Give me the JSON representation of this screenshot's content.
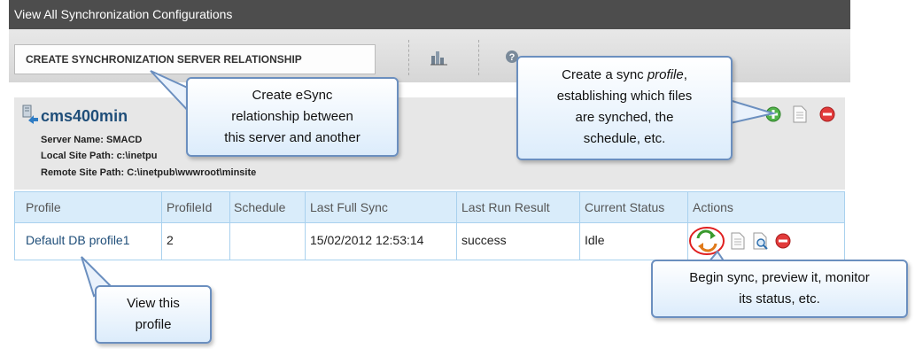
{
  "window": {
    "title": "View All Synchronization Configurations"
  },
  "toolbar": {
    "create_label": "CREATE SYNCHRONIZATION SERVER RELATIONSHIP"
  },
  "server": {
    "name": "cms400min",
    "server_name_label": "Server Name:",
    "server_name_value": "SMACD",
    "local_label": "Local Site Path:",
    "local_value": "c:\\inetpu",
    "remote_label": "Remote Site Path:",
    "remote_value": "C:\\inetpub\\wwwroot\\minsite"
  },
  "table": {
    "headers": [
      "Profile",
      "ProfileId",
      "Schedule",
      "Last Full Sync",
      "Last Run Result",
      "Current Status",
      "Actions"
    ],
    "rows": [
      {
        "profile": "Default DB profile1",
        "profile_id": "2",
        "schedule": "",
        "last_full_sync": "15/02/2012 12:53:14",
        "last_run_result": "success",
        "current_status": "Idle"
      }
    ]
  },
  "callouts": {
    "esync_line1": "Create eSync",
    "esync_line2": "relationship between",
    "esync_line3": "this server and another",
    "profile_line1": "Create a sync ",
    "profile_italic": "profile",
    "profile_line1_end": ",",
    "profile_line2": "establishing which files",
    "profile_line3": "are synched, the",
    "profile_line4": "schedule, etc.",
    "begin_line1": "Begin sync, preview it, monitor",
    "begin_line2": "its status, etc.",
    "view_line1": "View this",
    "view_line2": "profile"
  },
  "icons": {
    "server": "server-sync-icon",
    "add": "add-profile-icon",
    "doc": "document-icon",
    "delete": "delete-icon",
    "sync": "sync-start-icon",
    "preview": "preview-icon",
    "monitor": "monitor-icon",
    "help": "help-icon",
    "chart": "chart-icon"
  },
  "colors": {
    "titlebar": "#4d4d4d",
    "header": "#d9ecfa",
    "link": "#1f4e79",
    "callout_border": "#6b8fbf"
  }
}
